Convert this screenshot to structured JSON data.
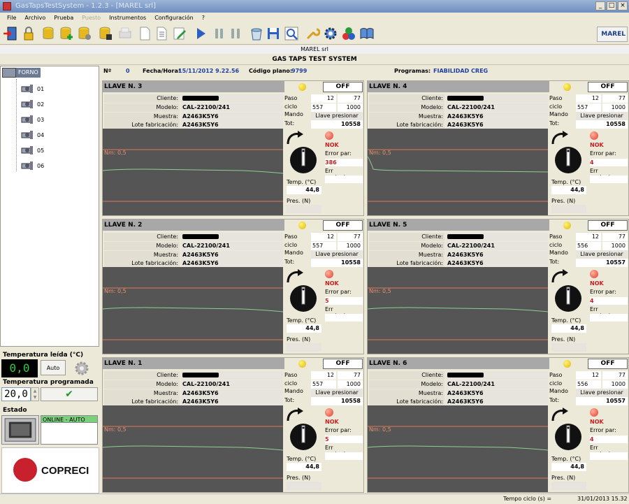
{
  "window": {
    "title": "GasTapsTestSystem - 1.2.3 - [MAREL srl]"
  },
  "menu": [
    {
      "label": "File",
      "enabled": true
    },
    {
      "label": "Archivo",
      "enabled": true
    },
    {
      "label": "Prueba",
      "enabled": true
    },
    {
      "label": "Puesto",
      "enabled": false
    },
    {
      "label": "Instrumentos",
      "enabled": true
    },
    {
      "label": "Configuración",
      "enabled": true
    },
    {
      "label": "?",
      "enabled": true
    }
  ],
  "toolbar_icons": [
    "exit-icon",
    "lock-icon",
    "database-icon",
    "database-add-icon",
    "database-settings-icon",
    "database-lock-icon",
    "printer-icon",
    "new-document-icon",
    "document-list-icon",
    "edit-icon",
    "play-icon",
    "pause-icon",
    "stop-icon",
    "bucket-icon",
    "save-icon",
    "zoom-icon",
    "wrench-icon",
    "gear-icon",
    "colors-icon",
    "book-icon"
  ],
  "brand": {
    "logo_text": "MAREL",
    "company": "MAREL srl",
    "app_title": "GAS TAPS TEST SYSTEM"
  },
  "tree": {
    "root": "FORNO",
    "items": [
      "01",
      "02",
      "03",
      "04",
      "05",
      "06"
    ]
  },
  "info": {
    "n_label": "Nº",
    "n_value": "0",
    "datetime_label": "Fecha/Hora:",
    "datetime_value": "15/11/2012 9.22.56",
    "plan_label": "Código plano:",
    "plan_value": "9799",
    "programs_label": "Programas:",
    "programs_value": "FIABILIDAD CREG"
  },
  "labels": {
    "cliente": "Cliente:",
    "modelo": "Modelo:",
    "muestra": "Muestra:",
    "lote": "Lote fabricación:",
    "paso": "Paso",
    "ciclo": "ciclo",
    "mando": "Mando",
    "tot": "Tot:",
    "err_par": "Error par:",
    "err_contactos": "Err contactos:",
    "temp": "Temp. (°C)",
    "pres": "Pres. (N)",
    "nm": "Nm: 0,5"
  },
  "panels": [
    {
      "title": "LLAVE N. 3",
      "off": "OFF",
      "modelo": "CAL-22100/241",
      "muestra": "A2463K5Y6",
      "lote": "A2463K5Y6",
      "paso_a": "12",
      "paso_b": "77",
      "ciclo_a": "557",
      "ciclo_b": "1000",
      "mando": "Llave presionar",
      "tot": "10558",
      "status": "NOK",
      "error_par": "386",
      "temp": "44,8"
    },
    {
      "title": "LLAVE N. 4",
      "off": "OFF",
      "modelo": "CAL-22100/241",
      "muestra": "A2463K5Y6",
      "lote": "A2463K5Y6",
      "paso_a": "12",
      "paso_b": "77",
      "ciclo_a": "557",
      "ciclo_b": "1000",
      "mando": "Llave presionar",
      "tot": "10558",
      "status": "NOK",
      "error_par": "4",
      "temp": "44,8"
    },
    {
      "title": "LLAVE N. 2",
      "off": "OFF",
      "modelo": "CAL-22100/241",
      "muestra": "A2463K5Y6",
      "lote": "A2463K5Y6",
      "paso_a": "12",
      "paso_b": "77",
      "ciclo_a": "557",
      "ciclo_b": "1000",
      "mando": "Llave presionar",
      "tot": "10558",
      "status": "NOK",
      "error_par": "5",
      "temp": "44,8"
    },
    {
      "title": "LLAVE N. 5",
      "off": "OFF",
      "modelo": "CAL-22100/241",
      "muestra": "A2463K5Y6",
      "lote": "A2463K5Y6",
      "paso_a": "12",
      "paso_b": "77",
      "ciclo_a": "556",
      "ciclo_b": "1000",
      "mando": "Llave presionar",
      "tot": "10557",
      "status": "NOK",
      "error_par": "4",
      "temp": "44,8"
    },
    {
      "title": "LLAVE N. 1",
      "off": "OFF",
      "modelo": "CAL-22100/241",
      "muestra": "A2463K5Y6",
      "lote": "A2463K5Y6",
      "paso_a": "12",
      "paso_b": "77",
      "ciclo_a": "557",
      "ciclo_b": "1000",
      "mando": "Llave presionar",
      "tot": "10558",
      "status": "NOK",
      "error_par": "5",
      "temp": "44,8"
    },
    {
      "title": "LLAVE N. 6",
      "off": "OFF",
      "modelo": "CAL-22100/241",
      "muestra": "A2463K5Y6",
      "lote": "A2463K5Y6",
      "paso_a": "12",
      "paso_b": "77",
      "ciclo_a": "556",
      "ciclo_b": "1000",
      "mando": "Llave presionar",
      "tot": "10557",
      "status": "NOK",
      "error_par": "4",
      "temp": "44,8"
    }
  ],
  "side": {
    "temp_read_label": "Temperatura leída (°C)",
    "temp_read_value": "0,0",
    "auto_label": "Auto",
    "temp_prog_label": "Temperatura programada",
    "temp_prog_value": "20,0",
    "estado_label": "Estado",
    "estado_value": "ONLINE - AUTO",
    "copreci": "COPRECI"
  },
  "statusbar": {
    "cycle_label": "Tempo ciclo (s) =",
    "datetime": "31/01/2013 15.32"
  },
  "colors": {
    "graph_bg": "#555555",
    "graph_line": "#8fd08f",
    "limit_line": "#e07858",
    "nok": "#c82020",
    "online": "#7bd17b"
  }
}
